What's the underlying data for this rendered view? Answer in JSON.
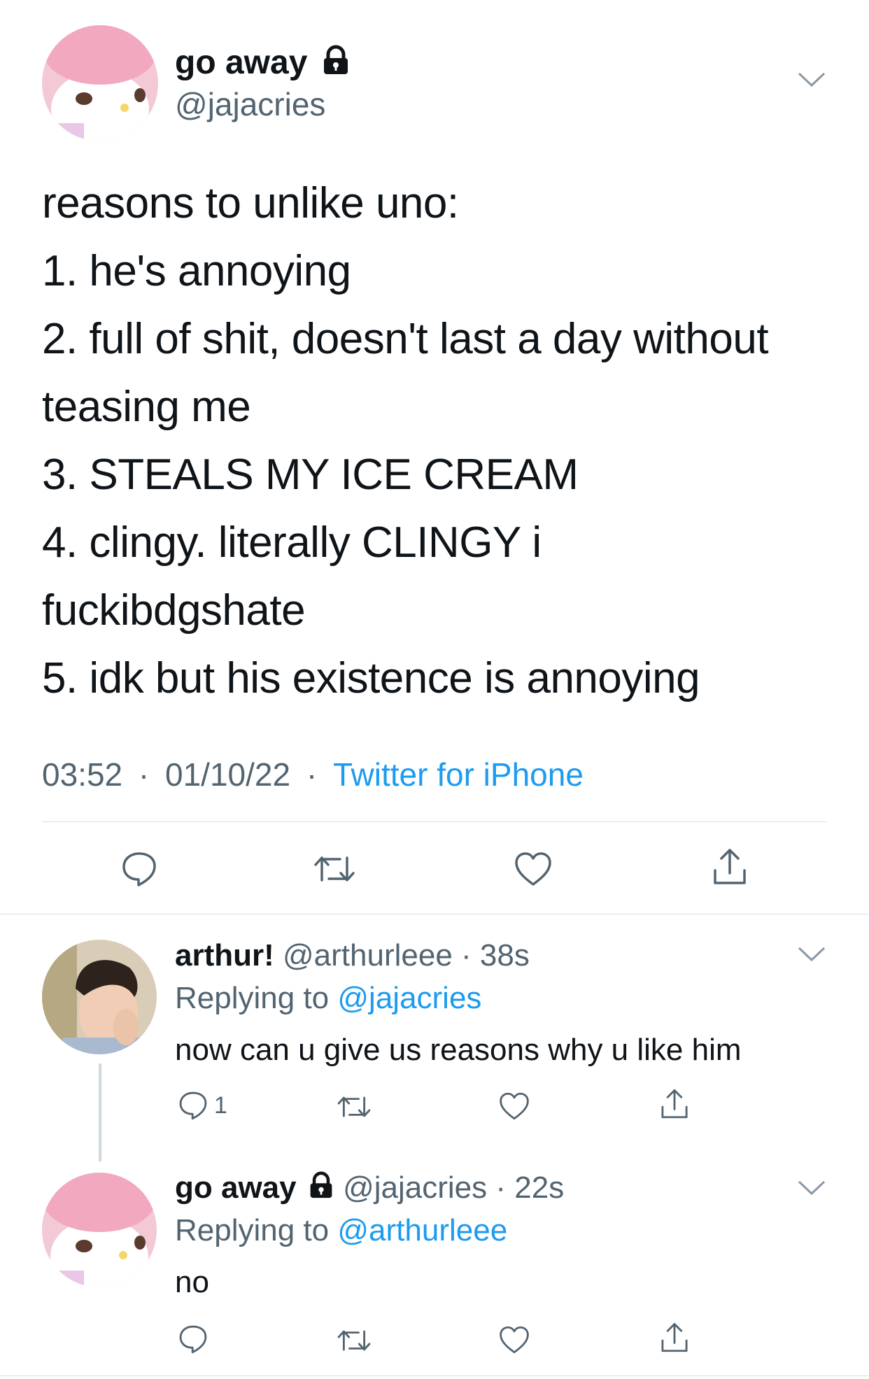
{
  "main_tweet": {
    "display_name": "go away",
    "handle": "@jajacries",
    "lines": [
      "reasons to unlike uno:",
      "1. he's annoying",
      "2. full of shit, doesn't last a day without",
      "teasing me",
      "3. STEALS MY ICE CREAM",
      "4. clingy. literally CLINGY i",
      "fuckibdgshate",
      "5. idk but his existence is annoying"
    ],
    "time": "03:52",
    "date": "01/10/22",
    "source": "Twitter for iPhone",
    "separator": "·"
  },
  "reply1": {
    "display_name": "arthur!",
    "handle": "@arthurleee",
    "age": "38s",
    "replying_prefix": "Replying to",
    "replying_to": "@jajacries",
    "text": "now can u give us reasons why u like him",
    "reply_count": "1"
  },
  "reply2": {
    "display_name": "go away",
    "handle": "@jajacries",
    "age": "22s",
    "replying_prefix": "Replying to",
    "replying_to": "@arthurleee",
    "text": "no"
  },
  "colors": {
    "text": "#0f1419",
    "secondary": "#536471",
    "link": "#1d9bf0",
    "divider": "#d9dde0"
  },
  "icons": [
    "lock-icon",
    "chevron-down-icon",
    "reply-icon",
    "retweet-icon",
    "like-icon",
    "share-icon"
  ]
}
